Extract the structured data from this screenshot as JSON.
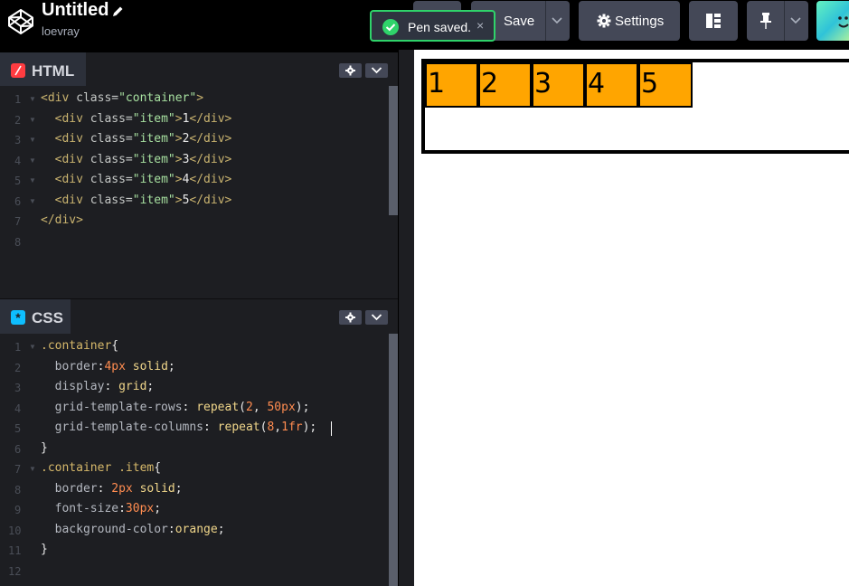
{
  "header": {
    "title": "Untitled",
    "user": "loevray",
    "save_label": "Save",
    "settings_label": "Settings"
  },
  "toast": {
    "message": "Pen saved.",
    "close": "×"
  },
  "html_pane": {
    "label": "HTML",
    "line_numbers": [
      "1",
      "2",
      "3",
      "4",
      "5",
      "6",
      "7",
      "8"
    ]
  },
  "css_pane": {
    "label": "CSS",
    "line_numbers": [
      "1",
      "2",
      "3",
      "4",
      "5",
      "6",
      "7",
      "8",
      "9",
      "10",
      "11",
      "12"
    ]
  },
  "html_code": [
    [
      [
        "c-tag",
        "<div "
      ],
      [
        "c-attr",
        "class="
      ],
      [
        "c-str",
        "\"container\""
      ],
      [
        "c-tag",
        ">"
      ]
    ],
    [
      [
        "c-tag",
        "  <div "
      ],
      [
        "c-attr",
        "class="
      ],
      [
        "c-str",
        "\"item\""
      ],
      [
        "c-tag",
        ">"
      ],
      [
        "c-txt",
        "1"
      ],
      [
        "c-tag",
        "</div>"
      ]
    ],
    [
      [
        "c-tag",
        "  <div "
      ],
      [
        "c-attr",
        "class="
      ],
      [
        "c-str",
        "\"item\""
      ],
      [
        "c-tag",
        ">"
      ],
      [
        "c-txt",
        "2"
      ],
      [
        "c-tag",
        "</div>"
      ]
    ],
    [
      [
        "c-tag",
        "  <div "
      ],
      [
        "c-attr",
        "class="
      ],
      [
        "c-str",
        "\"item\""
      ],
      [
        "c-tag",
        ">"
      ],
      [
        "c-txt",
        "3"
      ],
      [
        "c-tag",
        "</div>"
      ]
    ],
    [
      [
        "c-tag",
        "  <div "
      ],
      [
        "c-attr",
        "class="
      ],
      [
        "c-str",
        "\"item\""
      ],
      [
        "c-tag",
        ">"
      ],
      [
        "c-txt",
        "4"
      ],
      [
        "c-tag",
        "</div>"
      ]
    ],
    [
      [
        "c-tag",
        "  <div "
      ],
      [
        "c-attr",
        "class="
      ],
      [
        "c-str",
        "\"item\""
      ],
      [
        "c-tag",
        ">"
      ],
      [
        "c-txt",
        "5"
      ],
      [
        "c-tag",
        "</div>"
      ]
    ],
    [
      [
        "c-tag",
        "</div>"
      ]
    ],
    []
  ],
  "css_code": [
    [
      [
        "c-sel",
        ".container"
      ],
      [
        "c-punc",
        "{"
      ]
    ],
    [
      [
        "c-prop",
        "  border"
      ],
      [
        "c-punc",
        ":"
      ],
      [
        "c-num",
        "4px"
      ],
      [
        "c-val",
        " solid"
      ],
      [
        "c-punc",
        ";"
      ]
    ],
    [
      [
        "c-prop",
        "  display"
      ],
      [
        "c-punc",
        ": "
      ],
      [
        "c-val",
        "grid"
      ],
      [
        "c-punc",
        ";"
      ]
    ],
    [
      [
        "c-prop",
        "  grid-template-rows"
      ],
      [
        "c-punc",
        ": "
      ],
      [
        "c-val",
        "repeat"
      ],
      [
        "c-punc",
        "("
      ],
      [
        "c-num",
        "2"
      ],
      [
        "c-punc",
        ", "
      ],
      [
        "c-num",
        "50px"
      ],
      [
        "c-punc",
        ");"
      ]
    ],
    [
      [
        "c-prop",
        "  grid-template-columns"
      ],
      [
        "c-punc",
        ": "
      ],
      [
        "c-val",
        "repeat"
      ],
      [
        "c-punc",
        "("
      ],
      [
        "c-num",
        "8"
      ],
      [
        "c-punc",
        ","
      ],
      [
        "c-num",
        "1fr"
      ],
      [
        "c-punc",
        ");"
      ]
    ],
    [
      [
        "c-punc",
        "}"
      ]
    ],
    [
      [
        "c-sel",
        ".container .item"
      ],
      [
        "c-punc",
        "{"
      ]
    ],
    [
      [
        "c-prop",
        "  border"
      ],
      [
        "c-punc",
        ": "
      ],
      [
        "c-num",
        "2px"
      ],
      [
        "c-val",
        " solid"
      ],
      [
        "c-punc",
        ";"
      ]
    ],
    [
      [
        "c-prop",
        "  font-size"
      ],
      [
        "c-punc",
        ":"
      ],
      [
        "c-num",
        "30px"
      ],
      [
        "c-punc",
        ";"
      ]
    ],
    [
      [
        "c-prop",
        "  background-color"
      ],
      [
        "c-punc",
        ":"
      ],
      [
        "c-val",
        "orange"
      ],
      [
        "c-punc",
        ";"
      ]
    ],
    [
      [
        "c-punc",
        "}"
      ]
    ],
    []
  ],
  "preview": {
    "items": [
      "1",
      "2",
      "3",
      "4",
      "5"
    ]
  },
  "colors": {
    "accent_green": "#2fd36a",
    "html_icon": "#ff3c41",
    "css_icon": "#0ebeff",
    "item_bg": "#ffa500"
  }
}
